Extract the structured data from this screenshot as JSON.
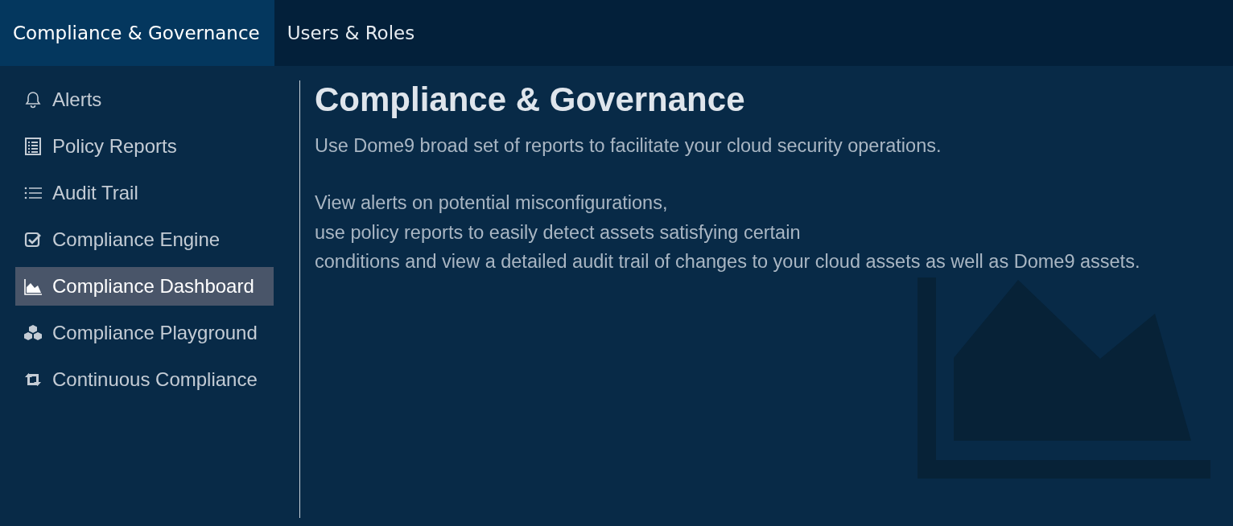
{
  "tabs": [
    {
      "label": "Compliance & Governance",
      "selected": true
    },
    {
      "label": "Users & Roles",
      "selected": false
    }
  ],
  "sidebar": {
    "items": [
      {
        "label": "Alerts",
        "selected": false
      },
      {
        "label": "Policy Reports",
        "selected": false
      },
      {
        "label": "Audit Trail",
        "selected": false
      },
      {
        "label": "Compliance Engine",
        "selected": false
      },
      {
        "label": "Compliance Dashboard",
        "selected": true
      },
      {
        "label": "Compliance Playground",
        "selected": false
      },
      {
        "label": "Continuous Compliance",
        "selected": false
      }
    ]
  },
  "content": {
    "title": "Compliance & Governance",
    "intro": "Use Dome9 broad set of reports to facilitate your cloud security operations.",
    "details": [
      "View alerts on potential misconfigurations,",
      "use policy reports to easily detect assets satisfying certain",
      "conditions and view a detailed audit trail of changes to your cloud assets as well as Dome9 assets."
    ]
  }
}
